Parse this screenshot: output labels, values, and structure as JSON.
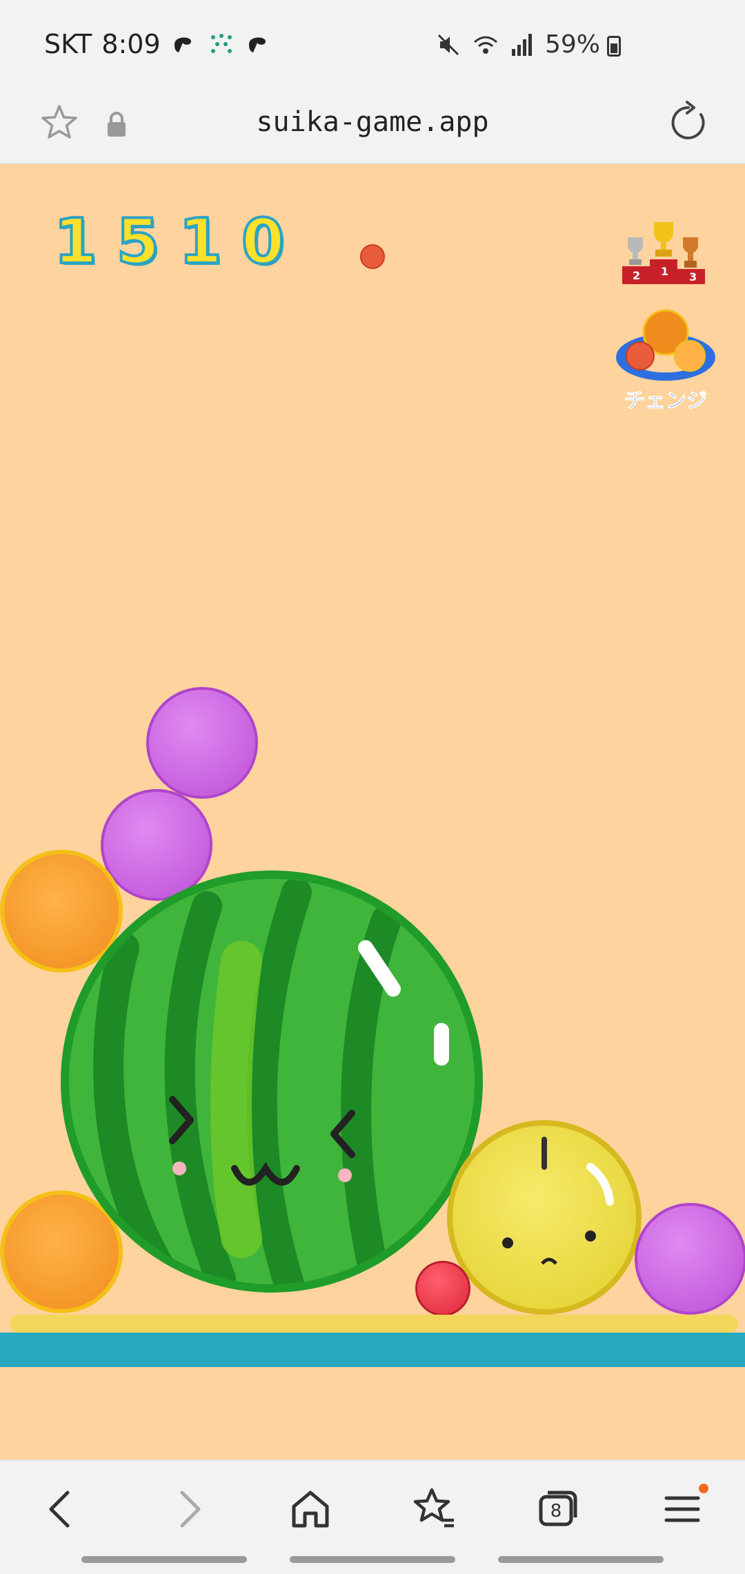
{
  "status": {
    "carrier": "SKT",
    "time": "8:09",
    "battery": "59%"
  },
  "browser": {
    "url": "suika-game.app",
    "tab_count": "8"
  },
  "game": {
    "score": "1510",
    "change_label": "チェンジ",
    "ranking_labels": [
      "2",
      "1",
      "3"
    ]
  },
  "icons": {
    "star": "star-icon",
    "lock": "lock-icon",
    "reload": "reload-icon",
    "back": "chevron-left-icon",
    "forward": "chevron-right-icon",
    "home": "home-icon",
    "bookmarks": "bookmarks-icon",
    "tabs": "tabs-icon",
    "menu": "menu-icon"
  },
  "colors": {
    "background": "#ffd39e",
    "score_fill": "#ffe02a",
    "score_outline": "#2aa3c4",
    "ground": "#28a8bf"
  }
}
